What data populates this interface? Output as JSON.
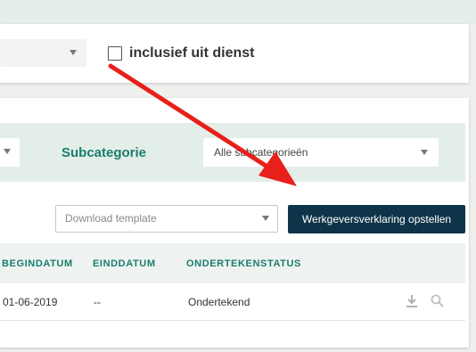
{
  "filters_top": {
    "checkbox_label": "inclusief uit dienst",
    "checkbox_checked": false
  },
  "filters": {
    "subcategory_label": "Subcategorie",
    "subcategory_value": "Alle subcategorieën"
  },
  "actions": {
    "download_placeholder": "Download template",
    "primary_button": "Werkgeversverklaring opstellen"
  },
  "table": {
    "columns": [
      "BEGINDATUM",
      "EINDDATUM",
      "ONDERTEKENSTATUS"
    ],
    "rows": [
      {
        "begindatum": "01-06-2019",
        "einddatum": "--",
        "status": "Ondertekend"
      }
    ]
  },
  "icons": [
    "download-icon",
    "search-icon",
    "chevron-down-icon"
  ],
  "colors": {
    "accent_teal": "#1a7d6b",
    "primary_button": "#0e3449",
    "annotation_arrow": "#e8201a",
    "filter_bar_bg": "#e3eee9"
  }
}
